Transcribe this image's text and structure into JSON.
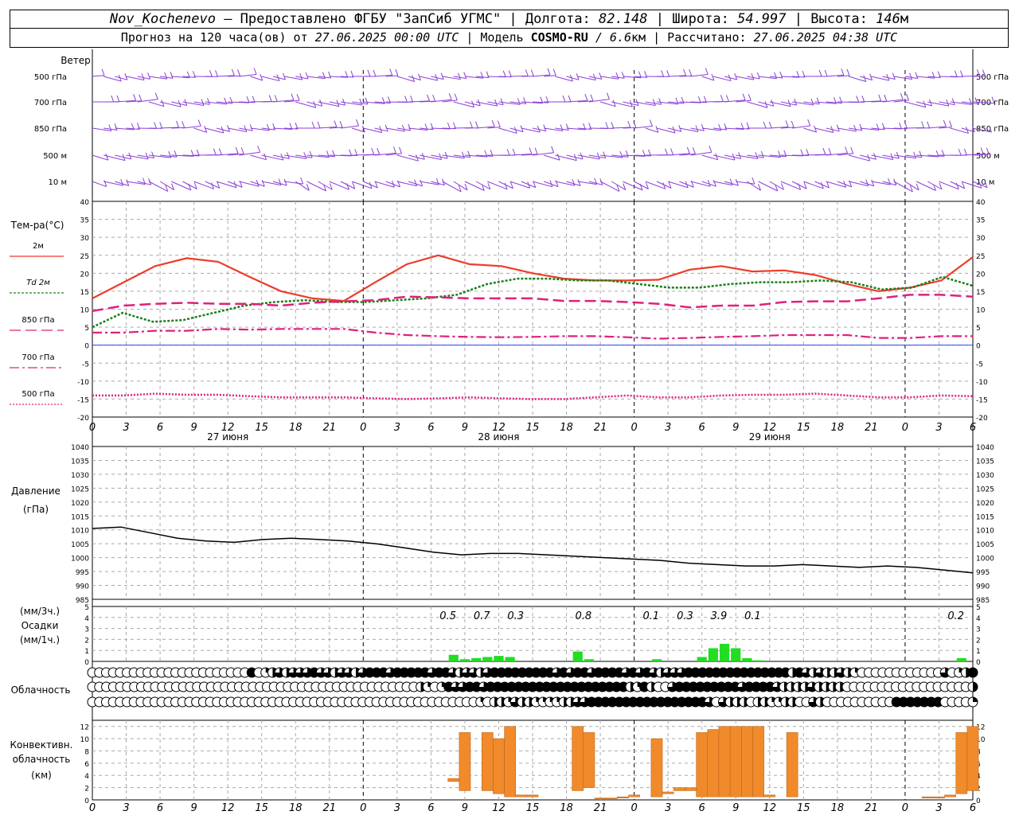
{
  "header": {
    "station": "Nov_Kochenevo",
    "provider": "– Предоставлено ФГБУ \"ЗапСиб УГМС\"",
    "lon_label": "Долгота:",
    "lon": "82.148",
    "lat_label": "Широта:",
    "lat": "54.997",
    "alt_label": "Высота:",
    "alt": "146",
    "alt_unit": "м",
    "forecast_prefix": "Прогноз на 120 часа(ов) от",
    "forecast_time": "27.06.2025 00:00 UTC",
    "model_label": "| Модель",
    "model": "COSMO-RU",
    "resolution": "/ 6.6",
    "res_unit": "км",
    "computed_label": "| Рассчитано:",
    "computed_time": "27.06.2025 04:38 UTC"
  },
  "hour_ticks": [
    "0",
    "3",
    "6",
    "9",
    "12",
    "15",
    "18",
    "21",
    "0",
    "3",
    "6",
    "9",
    "12",
    "15",
    "18",
    "21",
    "0",
    "3",
    "6",
    "9",
    "12",
    "15",
    "18",
    "21",
    "0",
    "3",
    "6"
  ],
  "day_labels": [
    "27 июня",
    "28 июня",
    "29 июня"
  ],
  "labels": {
    "wind_title": "Ветер",
    "wind_levels": [
      "500 гПа",
      "700 гПа",
      "850 гПа",
      "500  м",
      "10   м"
    ],
    "temp_title": "Тем-ра(°С)",
    "temp_legend": [
      "2м",
      "Td  2м",
      "850 гПа",
      "700 гПа",
      "500 гПа"
    ],
    "pressure_title": "Давление",
    "pressure_unit": "(гПа)",
    "precip_unit_top": "(мм/3ч.)",
    "precip_title": "Осадки",
    "precip_unit_bottom": "(мм/1ч.)",
    "cloud_title": "Облачность",
    "conv_title": "Конвективн.",
    "conv_title2": "облачность",
    "conv_unit": "(км)"
  },
  "colors": {
    "t2m": "#ee3b2a",
    "td2m": "#1a7f1a",
    "t850": "#e0207a",
    "t700": "#e0207a",
    "t500": "#e0207a",
    "wind": "#8a3fd6",
    "pressure": "#000000",
    "precip": "#22dd22",
    "conv": "#f08a2a"
  },
  "chart_data": [
    {
      "type": "line",
      "panel": "temperature",
      "ylim": [
        -20,
        40
      ],
      "y_ticks": [
        40,
        35,
        30,
        25,
        20,
        15,
        10,
        5,
        0,
        -5,
        -10,
        -15,
        -20
      ],
      "x_hours": [
        0,
        3,
        6,
        9,
        12,
        15,
        18,
        21,
        24,
        27,
        30,
        33,
        36,
        39,
        42,
        45,
        48,
        51,
        54,
        57,
        60,
        63,
        66,
        69,
        72,
        75,
        78
      ],
      "series": [
        {
          "name": "2м",
          "values": [
            13,
            17.5,
            22,
            24.2,
            23.2,
            19,
            15,
            13,
            12.3,
            17.5,
            22.5,
            25,
            22.5,
            22,
            20,
            18.5,
            18,
            18,
            18.2,
            21,
            22,
            20.5,
            20.8,
            19.5,
            17,
            15,
            16,
            18,
            24.5
          ]
        },
        {
          "name": "Td  2м",
          "values": [
            5,
            9,
            6.5,
            7,
            9,
            11,
            12,
            12.5,
            12,
            12,
            12.5,
            13,
            14,
            17,
            18.5,
            18.5,
            18,
            18,
            17,
            16,
            16,
            17,
            17.5,
            17.5,
            18,
            17.5,
            15.5,
            16,
            19,
            16.5
          ]
        },
        {
          "name": "850 гПа",
          "values": [
            9.5,
            11,
            11.5,
            11.8,
            11.5,
            11.5,
            11,
            11.8,
            12.2,
            12.5,
            13.5,
            13.3,
            13,
            13,
            13,
            12.3,
            12.3,
            12,
            11.5,
            10.5,
            11,
            11,
            12,
            12.2,
            12.2,
            13,
            14,
            14,
            13.5
          ]
        },
        {
          "name": "700 гПа",
          "values": [
            3.5,
            3.5,
            4,
            4,
            4.5,
            4.3,
            4.5,
            4.5,
            4.5,
            3.5,
            2.8,
            2.5,
            2.3,
            2.2,
            2.3,
            2.5,
            2.5,
            2.2,
            1.8,
            2,
            2.3,
            2.5,
            2.8,
            2.8,
            2.8,
            2,
            2,
            2.5,
            2.5
          ]
        },
        {
          "name": "500 гПа",
          "values": [
            -14,
            -14,
            -13.5,
            -13.8,
            -13.8,
            -14.2,
            -14.5,
            -14.5,
            -14.5,
            -14.8,
            -15,
            -14.8,
            -14.5,
            -14.8,
            -15,
            -15,
            -14.5,
            -14,
            -14.5,
            -14.5,
            -14,
            -13.8,
            -13.8,
            -13.5,
            -14,
            -14.5,
            -14.5,
            -14,
            -14.2
          ]
        }
      ]
    },
    {
      "type": "line",
      "panel": "pressure",
      "ylim": [
        985,
        1040
      ],
      "y_ticks": [
        1040,
        1035,
        1030,
        1025,
        1020,
        1015,
        1010,
        1005,
        1000,
        995,
        990,
        985
      ],
      "series": [
        {
          "name": "pressure",
          "values": [
            1010.5,
            1011,
            1009,
            1007,
            1006,
            1005.5,
            1006.5,
            1007,
            1006.5,
            1006,
            1005,
            1003.5,
            1002,
            1001,
            1001.5,
            1001.5,
            1001,
            1000.5,
            1000,
            999.5,
            999,
            998,
            997.5,
            997,
            997,
            997.5,
            997,
            996.5,
            997,
            996.5,
            995.5,
            994.5
          ]
        }
      ]
    },
    {
      "type": "bar",
      "panel": "precipitation",
      "ylim": [
        0,
        5
      ],
      "y_ticks": [
        5,
        4,
        3,
        2,
        1,
        0
      ],
      "sums_3h": [
        {
          "hour": 31.5,
          "value": "0.5"
        },
        {
          "hour": 34.5,
          "value": "0.7"
        },
        {
          "hour": 37.5,
          "value": "0.3"
        },
        {
          "hour": 43.5,
          "value": "0.8"
        },
        {
          "hour": 49.5,
          "value": "0.1"
        },
        {
          "hour": 52.5,
          "value": "0.3"
        },
        {
          "hour": 55.5,
          "value": "3.9"
        },
        {
          "hour": 58.5,
          "value": "0.1"
        },
        {
          "hour": 76.5,
          "value": "0.2"
        }
      ],
      "hourly": [
        {
          "hour": 32,
          "value": 0.6
        },
        {
          "hour": 33,
          "value": 0.2
        },
        {
          "hour": 34,
          "value": 0.3
        },
        {
          "hour": 35,
          "value": 0.4
        },
        {
          "hour": 36,
          "value": 0.5
        },
        {
          "hour": 37,
          "value": 0.4
        },
        {
          "hour": 43,
          "value": 0.9
        },
        {
          "hour": 44,
          "value": 0.2
        },
        {
          "hour": 50,
          "value": 0.2
        },
        {
          "hour": 54,
          "value": 0.4
        },
        {
          "hour": 55,
          "value": 1.2
        },
        {
          "hour": 56,
          "value": 1.6
        },
        {
          "hour": 57,
          "value": 1.2
        },
        {
          "hour": 58,
          "value": 0.3
        },
        {
          "hour": 59,
          "value": 0.1
        },
        {
          "hour": 77,
          "value": 0.3
        }
      ]
    },
    {
      "type": "bar",
      "panel": "convective_cloud",
      "ylim": [
        0,
        13
      ],
      "y_ticks": [
        12,
        10,
        8,
        6,
        4,
        2,
        0
      ],
      "bars": [
        {
          "hour": 32,
          "base": 3,
          "top": 3.5
        },
        {
          "hour": 33,
          "base": 1.5,
          "top": 11
        },
        {
          "hour": 35,
          "base": 1.5,
          "top": 11
        },
        {
          "hour": 36,
          "base": 1,
          "top": 10
        },
        {
          "hour": 37,
          "base": 0.5,
          "top": 12
        },
        {
          "hour": 38,
          "base": 0.5,
          "top": 0.8
        },
        {
          "hour": 39,
          "base": 0.5,
          "top": 0.8
        },
        {
          "hour": 43,
          "base": 1.5,
          "top": 12
        },
        {
          "hour": 44,
          "base": 2,
          "top": 11
        },
        {
          "hour": 45,
          "base": 0.2,
          "top": 0.3
        },
        {
          "hour": 46,
          "base": 0.2,
          "top": 0.3
        },
        {
          "hour": 47,
          "base": 0.3,
          "top": 0.5
        },
        {
          "hour": 48,
          "base": 0.5,
          "top": 0.8
        },
        {
          "hour": 50,
          "base": 0.5,
          "top": 10
        },
        {
          "hour": 51,
          "base": 1,
          "top": 1.3
        },
        {
          "hour": 52,
          "base": 1.5,
          "top": 2
        },
        {
          "hour": 53,
          "base": 1.5,
          "top": 2
        },
        {
          "hour": 54,
          "base": 0.5,
          "top": 11
        },
        {
          "hour": 55,
          "base": 0.5,
          "top": 11.5
        },
        {
          "hour": 56,
          "base": 0.5,
          "top": 12
        },
        {
          "hour": 57,
          "base": 0.5,
          "top": 12
        },
        {
          "hour": 58,
          "base": 0.5,
          "top": 12
        },
        {
          "hour": 59,
          "base": 0.5,
          "top": 12
        },
        {
          "hour": 60,
          "base": 0.5,
          "top": 0.8
        },
        {
          "hour": 62,
          "base": 0.5,
          "top": 11
        },
        {
          "hour": 74,
          "base": 0.3,
          "top": 0.5
        },
        {
          "hour": 75,
          "base": 0.3,
          "top": 0.5
        },
        {
          "hour": 76,
          "base": 0.5,
          "top": 0.8
        },
        {
          "hour": 77,
          "base": 1,
          "top": 11
        },
        {
          "hour": 78,
          "base": 1.5,
          "top": 12
        }
      ]
    },
    {
      "type": "table",
      "panel": "cloud_cover",
      "rows": 3,
      "values_row1": [
        0,
        0,
        0,
        0,
        0,
        0,
        0,
        0,
        0,
        0,
        0,
        0,
        0,
        0,
        0,
        0,
        0,
        0,
        0,
        0,
        0,
        0,
        0,
        4,
        0,
        1,
        2,
        3,
        2,
        3,
        3,
        3,
        4,
        3,
        3,
        2,
        3,
        3,
        2,
        3,
        4,
        4,
        4,
        3,
        4,
        4,
        4,
        4,
        4,
        3,
        4,
        4,
        3,
        2,
        3,
        3,
        2,
        3,
        4,
        4,
        4,
        4,
        4,
        4,
        4,
        4,
        4,
        3,
        4,
        3,
        4,
        4,
        3,
        4,
        4,
        4,
        4,
        3,
        4,
        3,
        4,
        3,
        2,
        3,
        3,
        3,
        4,
        4,
        4,
        4,
        4,
        4,
        4,
        4,
        4,
        4,
        4,
        4,
        4,
        4,
        4,
        2,
        4,
        3,
        2,
        3,
        2,
        2,
        3,
        2,
        1,
        0,
        0,
        0,
        0,
        0,
        0,
        0,
        0,
        0,
        0,
        0,
        0,
        3,
        0,
        1,
        2,
        4
      ],
      "values_row2": [
        0,
        0,
        0,
        0,
        0,
        0,
        0,
        0,
        0,
        0,
        0,
        0,
        0,
        0,
        0,
        0,
        0,
        0,
        0,
        0,
        0,
        0,
        0,
        0,
        0,
        0,
        0,
        0,
        0,
        0,
        0,
        0,
        0,
        0,
        0,
        0,
        0,
        0,
        0,
        0,
        0,
        0,
        0,
        0,
        0,
        0,
        0,
        2,
        1,
        0,
        1,
        4,
        3,
        3,
        4,
        4,
        3,
        4,
        4,
        4,
        4,
        4,
        4,
        4,
        4,
        4,
        4,
        4,
        4,
        4,
        4,
        4,
        4,
        4,
        4,
        4,
        4,
        2,
        1,
        4,
        2,
        0,
        0,
        3,
        4,
        4,
        4,
        4,
        4,
        4,
        4,
        4,
        4,
        3,
        4,
        4,
        4,
        4,
        3,
        2,
        2,
        2,
        2,
        3,
        2,
        2,
        2,
        2,
        0,
        0,
        0,
        0,
        0,
        0,
        0,
        0,
        0,
        0,
        0,
        0,
        0,
        0,
        0,
        0,
        0,
        0,
        2
      ],
      "values_row3": [
        0,
        0,
        0,
        0,
        0,
        0,
        0,
        0,
        0,
        0,
        0,
        0,
        0,
        0,
        0,
        0,
        0,
        0,
        0,
        0,
        0,
        0,
        0,
        0,
        0,
        0,
        0,
        0,
        0,
        0,
        0,
        0,
        0,
        0,
        0,
        0,
        0,
        0,
        0,
        0,
        0,
        0,
        0,
        0,
        0,
        0,
        0,
        0,
        0,
        0,
        0,
        0,
        0,
        0,
        0,
        0,
        1,
        0,
        2,
        2,
        1,
        3,
        2,
        2,
        1,
        1,
        1,
        1,
        2,
        2,
        3,
        3,
        4,
        4,
        4,
        4,
        4,
        4,
        4,
        4,
        4,
        4,
        4,
        4,
        4,
        4,
        4,
        4,
        4,
        3,
        0,
        3,
        2,
        2,
        2,
        0,
        2,
        2,
        1,
        1,
        2,
        2,
        0,
        0,
        3,
        2,
        0,
        0,
        0,
        0,
        0,
        0,
        0,
        0,
        0,
        0,
        4,
        4,
        4,
        4,
        4,
        4,
        4,
        0,
        0,
        0,
        0,
        1
      ]
    }
  ]
}
